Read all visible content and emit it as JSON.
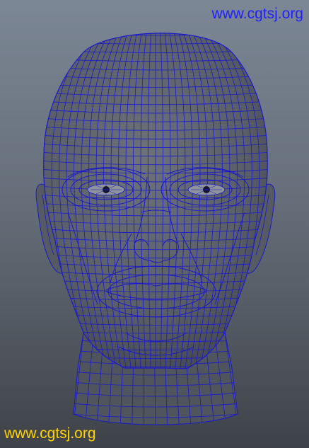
{
  "viewport": {
    "background": "#6b7480",
    "mesh": {
      "subject": "human-head",
      "shading": "gray",
      "wireframe_color": "#1a1acc",
      "surface_color": "#5f636c"
    }
  },
  "watermarks": {
    "top_right": "www.cgtsj.org",
    "bottom_left": "www.cgtsj.org",
    "top_right_color": "#1f1fff",
    "bottom_left_color": "#ffd400"
  }
}
